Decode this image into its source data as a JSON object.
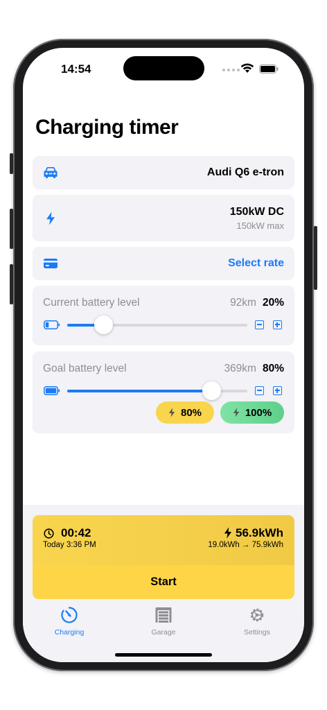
{
  "status_bar": {
    "time": "14:54"
  },
  "page": {
    "title": "Charging timer"
  },
  "vehicle": {
    "icon": "car-icon",
    "name": "Audi Q6 e-tron"
  },
  "charger": {
    "icon": "lightning-icon",
    "power": "150kW DC",
    "max": "150kW max"
  },
  "rate": {
    "icon": "credit-card-icon",
    "action": "Select rate"
  },
  "current_battery": {
    "label": "Current battery level",
    "range": "92km",
    "percent": "20%",
    "level": 0.2,
    "icon": "battery-low-icon"
  },
  "goal_battery": {
    "label": "Goal battery level",
    "range": "369km",
    "percent": "80%",
    "level": 0.8,
    "icon": "battery-full-icon",
    "presets": [
      "80%",
      "100%"
    ]
  },
  "timer": {
    "icon": "timer-icon",
    "duration": "00:42",
    "end_time": "Today 3:36 PM",
    "energy_icon": "bolt-icon",
    "energy": "56.9kWh",
    "energy_range": "19.0kWh → 75.9kWh",
    "start_label": "Start"
  },
  "tabs": [
    {
      "label": "Charging",
      "icon": "charging-gauge-icon",
      "active": true
    },
    {
      "label": "Garage",
      "icon": "garage-icon",
      "active": false
    },
    {
      "label": "Settings",
      "icon": "gear-icon",
      "active": false
    }
  ],
  "colors": {
    "accent": "#1a7cf5",
    "yellow": "#fdd547",
    "green": "#6ddc97",
    "card_bg": "#f2f2f7"
  }
}
